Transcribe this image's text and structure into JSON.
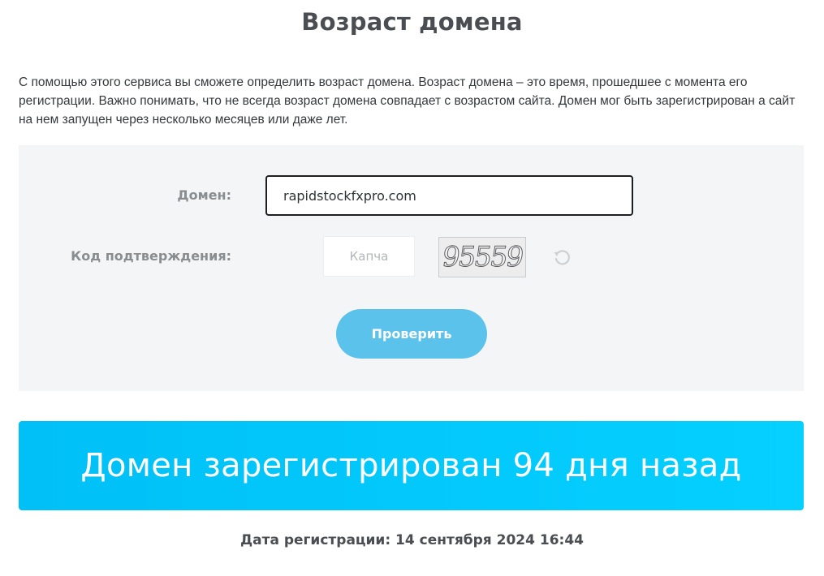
{
  "page": {
    "title": "Возраст домена",
    "description": "С помощью этого сервиса вы сможете определить возраст домена. Возраст домена – это время, прошедшее с момента его регистрации. Важно понимать, что не всегда возраст домена совпадает с возрастом сайта. Домен мог быть зарегистрирован а сайт на нем запущен через несколько месяцев или даже лет."
  },
  "form": {
    "domain_label": "Домен:",
    "domain_value": "rapidstockfxpro.com",
    "captcha_label": "Код подтверждения:",
    "captcha_placeholder": "Капча",
    "captcha_value": "",
    "captcha_image_text": "95559",
    "refresh_icon": "refresh-icon",
    "submit_label": "Проверить"
  },
  "result": {
    "headline": "Домен зарегистрирован 94 дня назад",
    "registration_date": "Дата регистрации: 14 сентября 2024 16:44"
  },
  "colors": {
    "banner": "#00c8ff",
    "button": "#5bc3eb",
    "panel": "#f3f5f6"
  }
}
